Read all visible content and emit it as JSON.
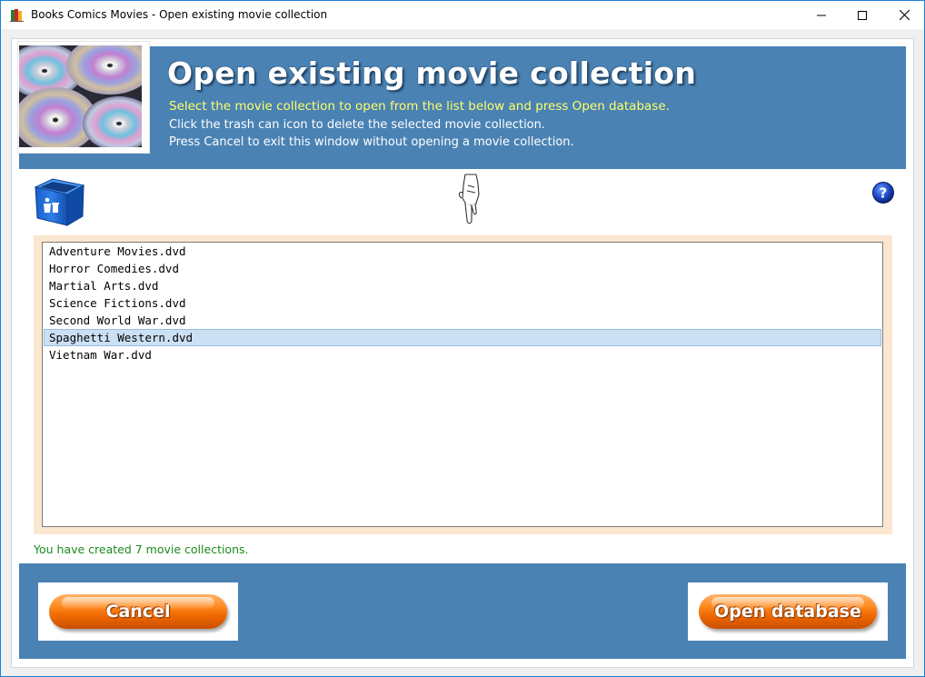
{
  "window": {
    "title": "Books Comics Movies - Open existing movie collection"
  },
  "header": {
    "title": "Open existing movie collection",
    "line1": "Select the movie collection to open from the list below and press Open database.",
    "line2": "Click the trash can icon to delete the selected movie collection.",
    "line3": "Press Cancel to exit this window without opening a movie collection."
  },
  "toolbar": {
    "trash_icon": "trash-can-icon",
    "pointer_icon": "pointing-hand-icon",
    "help_icon": "help-icon",
    "help_glyph": "?"
  },
  "collections": {
    "items": [
      "Adventure Movies.dvd",
      "Horror Comedies.dvd",
      "Martial Arts.dvd",
      "Science Fictions.dvd",
      "Second World War.dvd",
      "Spaghetti Western.dvd",
      "Vietnam War.dvd"
    ],
    "selected": "Spaghetti Western.dvd"
  },
  "status": {
    "text": "You have created 7 movie collections."
  },
  "buttons": {
    "cancel_label": "Cancel",
    "open_label": "Open database"
  },
  "colors": {
    "header_bg": "#4a82b4",
    "subtitle": "#ffff66",
    "status": "#1a8a1a",
    "list_frame": "#fbe7cf",
    "selection": "#cce0f4",
    "button_orange": "#f06a00"
  }
}
